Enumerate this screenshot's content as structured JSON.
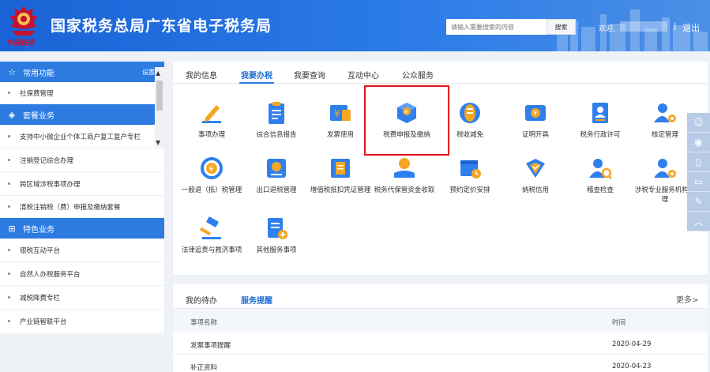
{
  "header": {
    "title": "国家税务总局广东省电子税务局",
    "logo_text": "中国税务",
    "search_placeholder": "请输入需要搜索的内容",
    "search_button": "搜索",
    "welcome": "欢迎,",
    "separator": "|",
    "logout": "退出"
  },
  "sidebar": {
    "sections": [
      {
        "title": "常用功能",
        "setting": "设置",
        "icon": "star-icon",
        "items": [
          "社保费管理"
        ]
      },
      {
        "title": "套餐业务",
        "icon": "layers-icon",
        "items": [
          "支持中小微企业个体工商户复工复产专栏",
          "注销登记综合办理",
          "跨区域涉税事项办理",
          "清税注销税（费）申报及缴纳套餐"
        ]
      },
      {
        "title": "特色业务",
        "icon": "grid-icon",
        "items": [
          "银税互动平台",
          "自然人办税服务平台",
          "减税降费专栏",
          "产业链智联平台"
        ]
      }
    ],
    "scroll_up": "▲",
    "scroll_down": "▼"
  },
  "tabs": [
    "我的信息",
    "我要办税",
    "我要查询",
    "互动中心",
    "公众服务"
  ],
  "active_tab": "我要办税",
  "services": [
    {
      "label": "事项办理",
      "icon": "pen-icon"
    },
    {
      "label": "综合信息报告",
      "icon": "clipboard-icon"
    },
    {
      "label": "发票使用",
      "icon": "invoice-icon"
    },
    {
      "label": "税费申报及缴纳",
      "icon": "tax-declare-icon"
    },
    {
      "label": "税收减免",
      "icon": "tax-relief-icon"
    },
    {
      "label": "证明开具",
      "icon": "certificate-icon"
    },
    {
      "label": "税务行政许可",
      "icon": "license-icon"
    },
    {
      "label": "核定管理",
      "icon": "user-gear-icon"
    },
    {
      "label": "一般退（抵）税管理",
      "icon": "refund-icon"
    },
    {
      "label": "出口退税管理",
      "icon": "export-refund-icon"
    },
    {
      "label": "增值税抵扣凭证管理",
      "icon": "vat-voucher-icon"
    },
    {
      "label": "税务代保管资金收取",
      "icon": "money-hand-icon"
    },
    {
      "label": "预约定价安排",
      "icon": "calendar-icon"
    },
    {
      "label": "纳税信用",
      "icon": "credit-shield-icon"
    },
    {
      "label": "稽查检查",
      "icon": "inspect-icon"
    },
    {
      "label": "涉税专业服务机构管理",
      "icon": "agency-icon"
    },
    {
      "label": "法律追责与救济事项",
      "icon": "gavel-icon"
    },
    {
      "label": "其他服务事项",
      "icon": "other-service-icon"
    }
  ],
  "floating_tools": [
    "wechat-icon",
    "weibo-icon",
    "mobile-icon",
    "tablet-icon",
    "edit-icon",
    "back-to-top-icon"
  ],
  "bottom": {
    "tabs": [
      "我的待办",
      "服务提醒"
    ],
    "active_tab": "服务提醒",
    "more": "更多>",
    "columns": [
      "事项名称",
      "时间"
    ],
    "rows": [
      {
        "name": "发票事项提醒",
        "time": "2020-04-29"
      },
      {
        "name": "补正资料",
        "time": "2020-04-23"
      }
    ]
  },
  "colors": {
    "brand_blue": "#2d7be0",
    "highlight_red": "#e3121b",
    "icon_orange": "#f5a623",
    "icon_blue": "#2f80ed"
  }
}
